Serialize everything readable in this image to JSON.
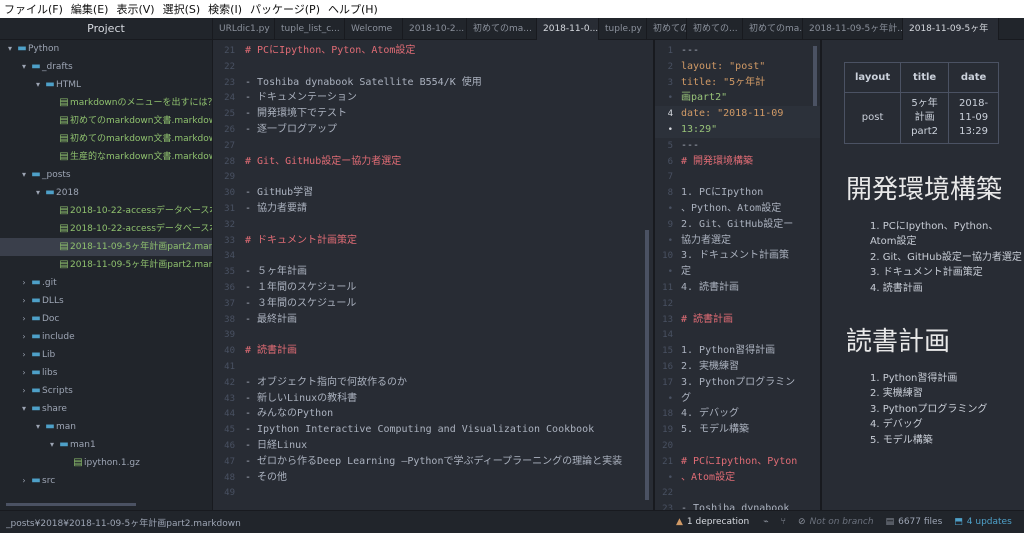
{
  "menu": [
    "ファイル(F)",
    "編集(E)",
    "表示(V)",
    "選択(S)",
    "検索(I)",
    "パッケージ(P)",
    "ヘルプ(H)"
  ],
  "tree": {
    "header": "Project",
    "rows": [
      {
        "label": "Python",
        "arrow": "▾",
        "kind": "folder",
        "indent": 0
      },
      {
        "label": "_drafts",
        "arrow": "▾",
        "kind": "folder",
        "indent": 1
      },
      {
        "label": "HTML",
        "arrow": "▾",
        "kind": "folder",
        "indent": 2
      },
      {
        "label": "markdownのメニューを出すには？.markdown",
        "arrow": "",
        "kind": "file",
        "indent": 3,
        "new": true
      },
      {
        "label": "初めてのmarkdown文書.markdown",
        "arrow": "",
        "kind": "file",
        "indent": 3,
        "new": true
      },
      {
        "label": "初めてのmarkdown文書.markdown.html",
        "arrow": "",
        "kind": "file",
        "indent": 3,
        "new": true
      },
      {
        "label": "生産的なmarkdown文書.markdown",
        "arrow": "",
        "kind": "file",
        "indent": 3,
        "new": true
      },
      {
        "label": "_posts",
        "arrow": "▾",
        "kind": "folder",
        "indent": 1
      },
      {
        "label": "2018",
        "arrow": "▾",
        "kind": "folder",
        "indent": 2
      },
      {
        "label": "2018-10-22-accessデータベース本格作成",
        "arrow": "",
        "kind": "file",
        "indent": 3,
        "new": true
      },
      {
        "label": "2018-10-22-accessデータベース本格作成",
        "arrow": "",
        "kind": "file",
        "indent": 3,
        "new": true
      },
      {
        "label": "2018-11-09-5ヶ年計画part2.markdown",
        "arrow": "",
        "kind": "file",
        "indent": 3,
        "new": true,
        "selected": true
      },
      {
        "label": "2018-11-09-5ヶ年計画part2.markdown",
        "arrow": "",
        "kind": "file",
        "indent": 3,
        "new": true
      },
      {
        "label": ".git",
        "arrow": "›",
        "kind": "folder",
        "indent": 1
      },
      {
        "label": "DLLs",
        "arrow": "›",
        "kind": "folder",
        "indent": 1
      },
      {
        "label": "Doc",
        "arrow": "›",
        "kind": "folder",
        "indent": 1
      },
      {
        "label": "include",
        "arrow": "›",
        "kind": "folder",
        "indent": 1
      },
      {
        "label": "Lib",
        "arrow": "›",
        "kind": "folder",
        "indent": 1
      },
      {
        "label": "libs",
        "arrow": "›",
        "kind": "folder",
        "indent": 1
      },
      {
        "label": "Scripts",
        "arrow": "›",
        "kind": "folder",
        "indent": 1
      },
      {
        "label": "share",
        "arrow": "▾",
        "kind": "folder",
        "indent": 1
      },
      {
        "label": "man",
        "arrow": "▾",
        "kind": "folder",
        "indent": 2
      },
      {
        "label": "man1",
        "arrow": "▾",
        "kind": "folder",
        "indent": 3
      },
      {
        "label": "ipython.1.gz",
        "arrow": "",
        "kind": "file",
        "indent": 4
      },
      {
        "label": "src",
        "arrow": "›",
        "kind": "folder",
        "indent": 1
      }
    ]
  },
  "tabs": [
    {
      "label": "URLdic1.py",
      "active": false
    },
    {
      "label": "tuple_list_c...",
      "active": false
    },
    {
      "label": "Welcome",
      "active": false
    },
    {
      "label": "2018-10-2...",
      "active": false
    },
    {
      "label": "初めてのma...",
      "active": false
    },
    {
      "label": "2018-11-0...",
      "active": true
    },
    {
      "label": "tuple.py",
      "active": false
    },
    {
      "label": "初めての...",
      "active": false
    },
    {
      "label": "初めての...",
      "active": false
    },
    {
      "label": "初めてのma...",
      "active": false
    },
    {
      "label": "2018-11-09-5ヶ年計...",
      "active": false
    },
    {
      "label": "2018-11-09-5ヶ年",
      "active": true
    }
  ],
  "editor1": {
    "lines": [
      {
        "n": "21",
        "t": "# PCにIpython、Pyton、Atom設定",
        "c": "h"
      },
      {
        "n": "22",
        "t": "",
        "c": "m"
      },
      {
        "n": "23",
        "t": "- Toshiba dynabook Satellite B554/K 使用",
        "c": "m"
      },
      {
        "n": "24",
        "t": "- ドキュメンテーション",
        "c": "m"
      },
      {
        "n": "25",
        "t": "- 開発環境下でテスト",
        "c": "m"
      },
      {
        "n": "26",
        "t": "- 逐一ブログアップ",
        "c": "m"
      },
      {
        "n": "27",
        "t": "",
        "c": "m"
      },
      {
        "n": "28",
        "t": "# Git、GitHub設定ー協力者選定",
        "c": "h"
      },
      {
        "n": "29",
        "t": "",
        "c": "m"
      },
      {
        "n": "30",
        "t": "- GitHub学習",
        "c": "m"
      },
      {
        "n": "31",
        "t": "- 協力者要請",
        "c": "m"
      },
      {
        "n": "32",
        "t": "",
        "c": "m"
      },
      {
        "n": "33",
        "t": "# ドキュメント計画策定",
        "c": "h"
      },
      {
        "n": "34",
        "t": "",
        "c": "m"
      },
      {
        "n": "35",
        "t": "- ５ヶ年計画",
        "c": "m"
      },
      {
        "n": "36",
        "t": "- １年間のスケジュール",
        "c": "m"
      },
      {
        "n": "37",
        "t": "- ３年間のスケジュール",
        "c": "m"
      },
      {
        "n": "38",
        "t": "- 最終計画",
        "c": "m"
      },
      {
        "n": "39",
        "t": "",
        "c": "m"
      },
      {
        "n": "40",
        "t": "# 読書計画",
        "c": "h"
      },
      {
        "n": "41",
        "t": "",
        "c": "m"
      },
      {
        "n": "42",
        "t": "- オブジェクト指向で何故作るのか",
        "c": "m"
      },
      {
        "n": "43",
        "t": "- 新しいLinuxの教科書",
        "c": "m"
      },
      {
        "n": "44",
        "t": "- みんなのPython",
        "c": "m"
      },
      {
        "n": "45",
        "t": "- Ipython Interactive Computing and Visualization Cookbook",
        "c": "m"
      },
      {
        "n": "46",
        "t": "- 日経Linux",
        "c": "m"
      },
      {
        "n": "47",
        "t": "- ゼロから作るDeep Learning ―Pythonで学ぶディープラーニングの理論と実装",
        "c": "m"
      },
      {
        "n": "48",
        "t": "- その他",
        "c": "m"
      },
      {
        "n": "49",
        "t": "",
        "c": "m"
      }
    ]
  },
  "editor2": {
    "lines": [
      {
        "n": "1",
        "t": "---",
        "c": "m"
      },
      {
        "n": "2",
        "t": "layout: \"post\"",
        "c": "y"
      },
      {
        "n": "3",
        "t": "title: \"5ヶ年計",
        "c": "y"
      },
      {
        "n": "•",
        "t": "画part2\"",
        "c": "s"
      },
      {
        "n": "4",
        "t": "date: \"2018-11-09",
        "c": "y",
        "cur": true
      },
      {
        "n": "•",
        "t": "13:29\"",
        "c": "s",
        "cur": true
      },
      {
        "n": "5",
        "t": "---",
        "c": "m"
      },
      {
        "n": "6",
        "t": "# 開発環境構築",
        "c": "h"
      },
      {
        "n": "7",
        "t": "",
        "c": "m"
      },
      {
        "n": "8",
        "t": "1. PCにIpython",
        "c": "m"
      },
      {
        "n": "•",
        "t": "、Python、Atom設定",
        "c": "m"
      },
      {
        "n": "9",
        "t": "2. Git、GitHub設定ー",
        "c": "m"
      },
      {
        "n": "•",
        "t": "協力者選定",
        "c": "m"
      },
      {
        "n": "10",
        "t": "3. ドキュメント計画策",
        "c": "m"
      },
      {
        "n": "•",
        "t": "定",
        "c": "m"
      },
      {
        "n": "11",
        "t": "4. 読書計画",
        "c": "m"
      },
      {
        "n": "12",
        "t": "",
        "c": "m"
      },
      {
        "n": "13",
        "t": "#   読書計画",
        "c": "h"
      },
      {
        "n": "14",
        "t": "",
        "c": "m"
      },
      {
        "n": "15",
        "t": "1. Python習得計画",
        "c": "m"
      },
      {
        "n": "16",
        "t": "2. 実機練習",
        "c": "m"
      },
      {
        "n": "17",
        "t": "3. Pythonプログラミン",
        "c": "m"
      },
      {
        "n": "•",
        "t": "グ",
        "c": "m"
      },
      {
        "n": "18",
        "t": "4. デバッグ",
        "c": "m"
      },
      {
        "n": "19",
        "t": "5. モデル構築",
        "c": "m"
      },
      {
        "n": "20",
        "t": "",
        "c": "m"
      },
      {
        "n": "21",
        "t": "# PCにIpython、Pyton",
        "c": "h"
      },
      {
        "n": "•",
        "t": "、Atom設定",
        "c": "h"
      },
      {
        "n": "22",
        "t": "",
        "c": "m"
      },
      {
        "n": "23",
        "t": "- Toshiba dynabook",
        "c": "m"
      }
    ]
  },
  "preview": {
    "table": {
      "headers": [
        "layout",
        "title",
        "date"
      ],
      "row": [
        "post",
        "5ヶ年\n計画\npart2",
        "2018-\n11-09\n13:29"
      ]
    },
    "h1a": "開発環境構築",
    "list1": [
      "PCにIpython、Python、Atom設定",
      "Git、GitHub設定ー協力者選定",
      "ドキュメント計画策定",
      "読書計画"
    ],
    "h1b": "読書計画",
    "list2": [
      "Python習得計画",
      "実機練習",
      "Pythonプログラミング",
      "デバッグ",
      "モデル構築"
    ]
  },
  "status": {
    "path": "_posts¥2018¥2018-11-09-5ヶ年計画part2.markdown",
    "deprecation": "1 deprecation",
    "branch": "Not on branch",
    "files": "6677 files",
    "updates": "4 updates"
  },
  "colors": {
    "heading": "#e06c75",
    "yaml": "#d19a66",
    "string": "#98c379",
    "accent": "#4ea0c8",
    "newfile": "#8fc16e"
  }
}
